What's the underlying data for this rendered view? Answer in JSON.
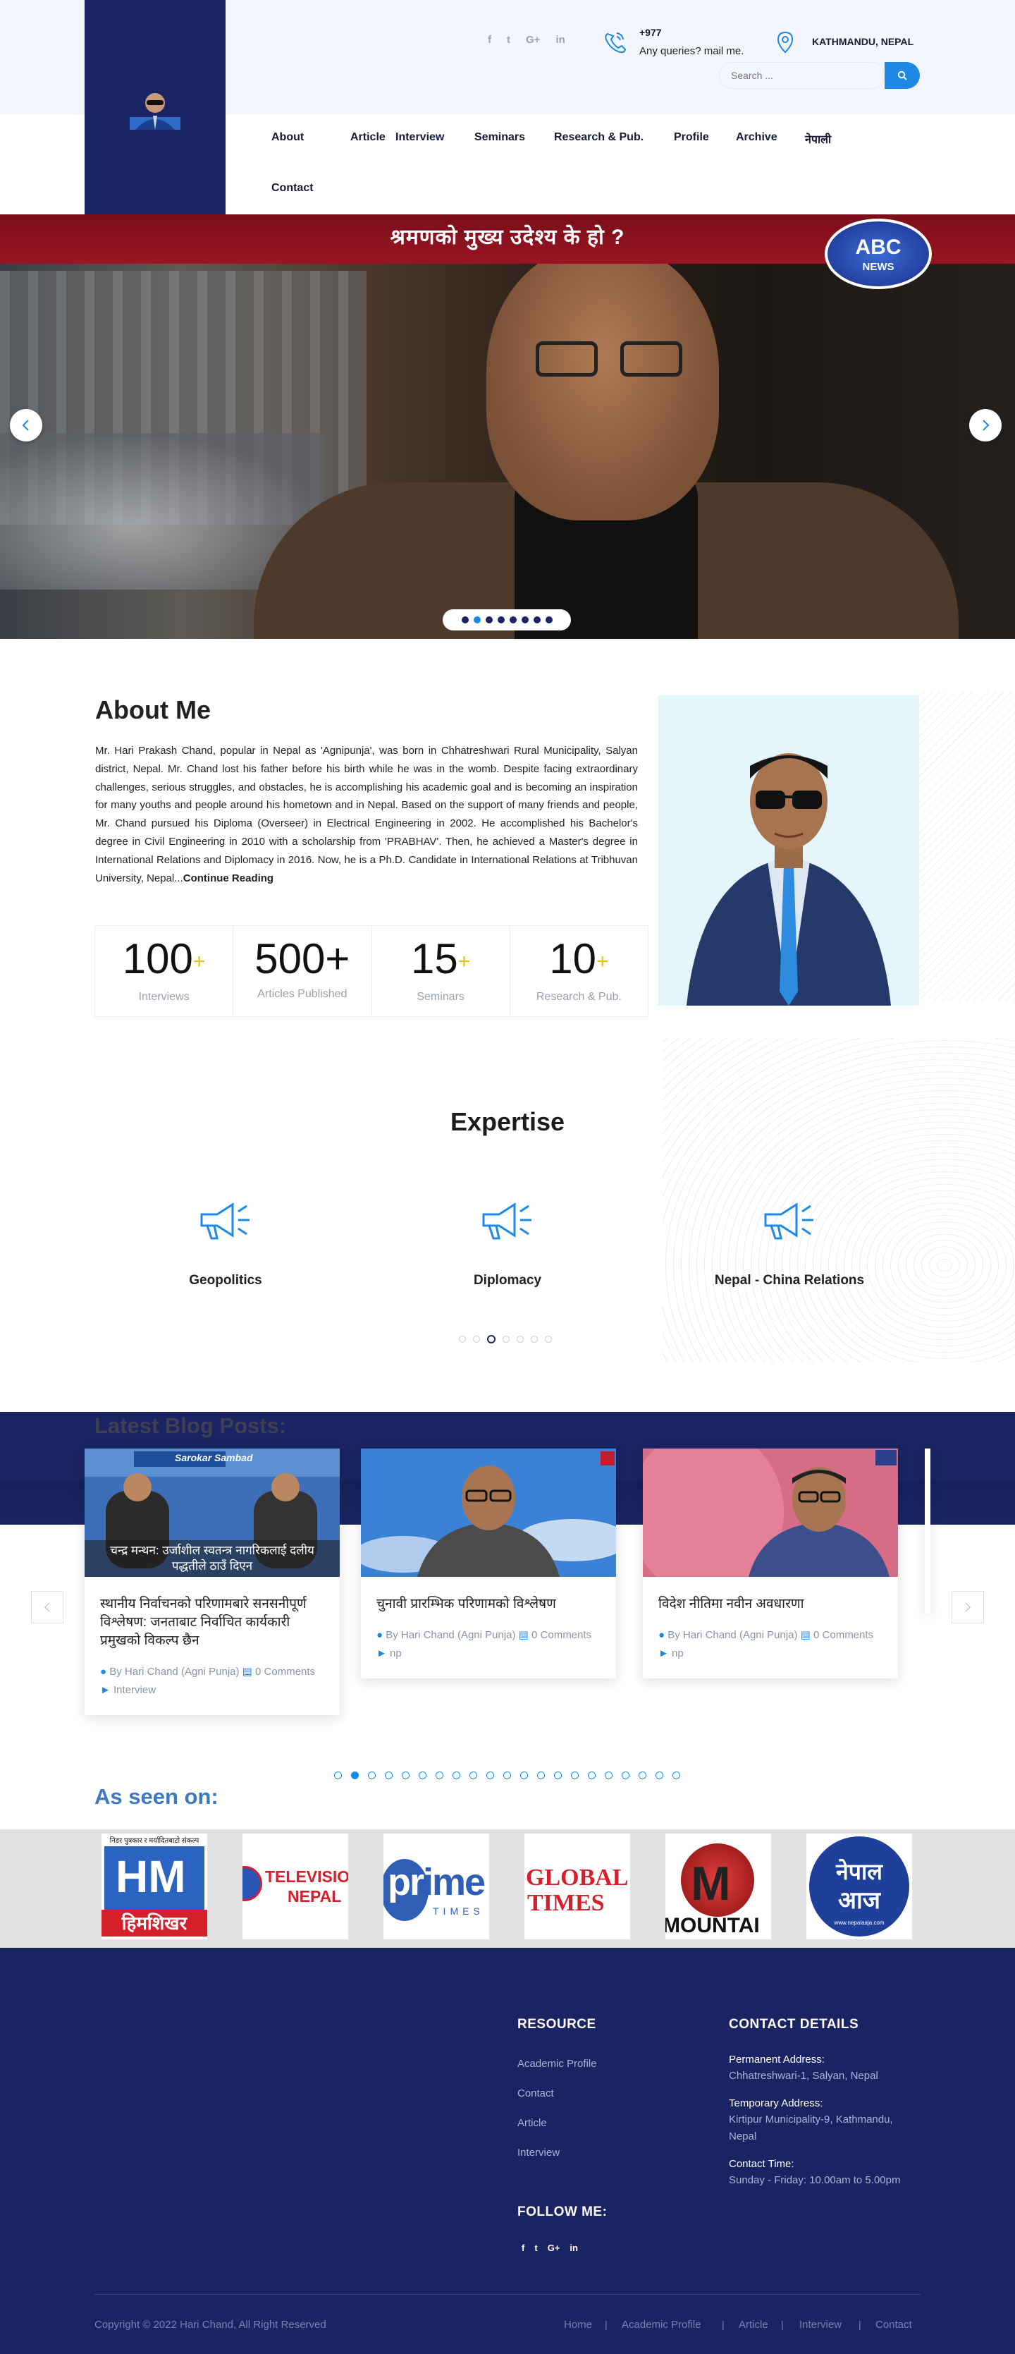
{
  "header": {
    "social": [
      "f",
      "t",
      "G+",
      "in"
    ],
    "phone": "+977",
    "phone_sub": "Any queries? mail me.",
    "location": "KATHMANDU, NEPAL",
    "search_placeholder": "Search ..."
  },
  "nav": [
    "About",
    "Article",
    "Interview",
    "Seminars",
    "Research & Pub.",
    "Profile",
    "Archive",
    "नेपाली",
    "Contact"
  ],
  "hero": {
    "banner": "श्रमणको मुख्य उदेश्य के हो ?",
    "channel": "ABC",
    "channel_sub": "NEWS",
    "slide_count": 8,
    "active_slide": 1
  },
  "about": {
    "title": "About Me",
    "text": "Mr. Hari Prakash Chand, popular in Nepal as 'Agnipunja', was born in Chhatreshwari Rural Municipality, Salyan district, Nepal. Mr. Chand lost his father before his birth while he was in the womb. Despite facing extraordinary challenges, serious struggles, and obstacles, he is accomplishing his academic goal and is becoming an inspiration for many youths and people around his hometown and in Nepal. Based on the support of many friends and people, Mr. Chand pursued his Diploma (Overseer) in Electrical Engineering in 2002. He accomplished his Bachelor's degree in Civil Engineering in 2010 with a scholarship from 'PRABHAV'. Then, he achieved a Master's degree in International Relations and Diplomacy in 2016. Now, he is a Ph.D. Candidate in International Relations at Tribhuvan University, Nepal...",
    "read_more": "Continue Reading",
    "stats": [
      {
        "num": "100",
        "suffix": "+",
        "label": "Interviews"
      },
      {
        "num": "500+",
        "suffix": "",
        "label": "Articles Published"
      },
      {
        "num": "15",
        "suffix": "+",
        "label": "Seminars"
      },
      {
        "num": "10",
        "suffix": "+",
        "label": "Research & Pub."
      }
    ]
  },
  "expertise": {
    "title": "Expertise",
    "items": [
      "Geopolitics",
      "Diplomacy",
      "Nepal - China Relations"
    ],
    "dot_count": 7,
    "active_dot": 2
  },
  "blog": {
    "title": "Latest Blog Posts:",
    "posts": [
      {
        "title": "स्थानीय निर्वाचनको परिणामबारे सनसनीपूर्ण विश्लेषण: जनताबाट निर्वाचित कार्यकारी प्रमुखको विकल्प छैन",
        "author": "By Hari Chand (Agni Punja)",
        "comments": "0 Comments",
        "category": "Interview",
        "img_caption": "चन्द्र मन्थन: उर्जाशील स्वतन्त्र नागरिकलाई दलीय पद्धतीले ठाउँ दिएन",
        "img_tag": "Sarokar Sambad"
      },
      {
        "title": "चुनावी प्रारम्भिक परिणामको विश्लेषण",
        "author": "By Hari Chand (Agni Punja)",
        "comments": "0 Comments",
        "category": "np"
      },
      {
        "title": "विदेश नीतिमा नवीन अवधारणा",
        "author": "By Hari Chand (Agni Punja)",
        "comments": "0 Comments",
        "category": "np"
      }
    ],
    "dot_count": 21,
    "active_dot": 1
  },
  "seen_on": {
    "title": "As seen on:",
    "logos": [
      {
        "name": "himshikhar",
        "top": "निडर पुत्रकार र मर्यादितबाटो संकल्प",
        "main": "हिमशिखर"
      },
      {
        "name": "abc-television-nepal",
        "main": "TELEVISIO",
        "sub": "NEPAL"
      },
      {
        "name": "prime-times",
        "main": "prime",
        "sub": "TIMES"
      },
      {
        "name": "global-times",
        "main": "GLOBAL",
        "sub": "TIMES"
      },
      {
        "name": "mountain",
        "main": "MOUNTAI"
      },
      {
        "name": "nepal-aaja",
        "main": "नेपाल",
        "sub": "आज",
        "url": "www.nepalaaja.com"
      }
    ]
  },
  "footer": {
    "resource_title": "RESOURCE",
    "resources": [
      "Academic Profile",
      "Contact",
      "Article",
      "Interview"
    ],
    "follow_title": "FOLLOW ME:",
    "follow": [
      "f",
      "t",
      "G+",
      "in"
    ],
    "contact_title": "CONTACT DETAILS",
    "permanent_label": "Permanent Address:",
    "permanent": "Chhatreshwari-1, Salyan, Nepal",
    "temporary_label": "Temporary Address:",
    "temporary": "Kirtipur Municipality-9, Kathmandu, Nepal",
    "time_label": "Contact Time:",
    "time": "Sunday - Friday: 10.00am to 5.00pm",
    "copyright": "Copyright © 2022 Hari Chand, All Right Reserved",
    "links": [
      "Home",
      "Academic Profile",
      "Article",
      "Interview",
      "Contact"
    ]
  },
  "colors": {
    "navy": "#1a2462",
    "accent": "#1e88e5",
    "yellow": "#f2c200"
  }
}
